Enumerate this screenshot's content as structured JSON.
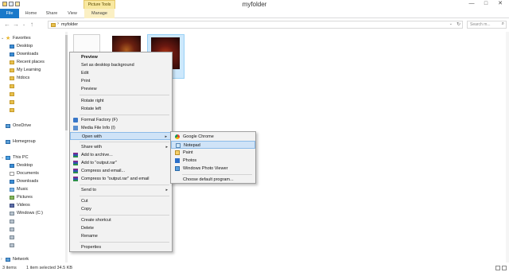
{
  "window": {
    "title": "myfolder",
    "contextual_header": "Picture Tools",
    "minimize": "—",
    "maximize": "□",
    "close": "✕"
  },
  "ribbon": {
    "tabs": [
      "File",
      "Home",
      "Share",
      "View",
      "Manage"
    ]
  },
  "address_bar": {
    "path": "myfolder",
    "separator": "›",
    "search_placeholder": "Search m..."
  },
  "nav_pane": {
    "favorites": "Favorites",
    "favorites_items": [
      "Desktop",
      "Downloads",
      "Recent places",
      "My Learning",
      "htdocs"
    ],
    "onedrive": "OneDrive",
    "homegroup": "Homegroup",
    "this_pc": "This PC",
    "this_pc_items": [
      "Desktop",
      "Documents",
      "Downloads",
      "Music",
      "Pictures",
      "Videos",
      "Windows (C:)"
    ],
    "network": "Network"
  },
  "context_menu": {
    "items": [
      {
        "label": "Preview",
        "bold": true
      },
      {
        "label": "Set as desktop background"
      },
      {
        "label": "Edit"
      },
      {
        "label": "Print"
      },
      {
        "label": "Preview"
      },
      {
        "label": "Rotate right"
      },
      {
        "label": "Rotate left"
      },
      {
        "label": "Format Factory (F)"
      },
      {
        "label": "Media File Info (I)"
      },
      {
        "label": "Open with"
      },
      {
        "label": "Share with"
      },
      {
        "label": "Add to archive..."
      },
      {
        "label": "Add to \"output.rar\""
      },
      {
        "label": "Compress and email..."
      },
      {
        "label": "Compress to \"output.rar\" and email"
      },
      {
        "label": "Send to"
      },
      {
        "label": "Cut"
      },
      {
        "label": "Copy"
      },
      {
        "label": "Create shortcut"
      },
      {
        "label": "Delete"
      },
      {
        "label": "Rename"
      },
      {
        "label": "Properties"
      }
    ],
    "submenu_arrow": "▸"
  },
  "open_with_submenu": {
    "items": [
      "Google Chrome",
      "Notepad",
      "Paint",
      "Photos",
      "Windows Photo Viewer",
      "Choose default program..."
    ]
  },
  "status_bar": {
    "item_count": "3 items",
    "selection": "1 item selected  34.5 KB"
  },
  "colors": {
    "file_tab": "#1979ca",
    "manage_tab": "#fbf0c4",
    "menu_highlight": "#cfe3f7",
    "selection": "#cde8fc"
  }
}
